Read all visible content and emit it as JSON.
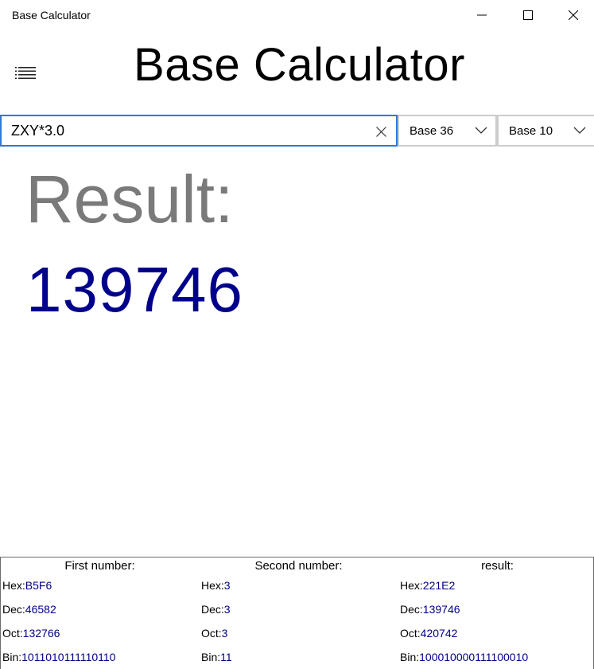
{
  "window": {
    "title": "Base Calculator",
    "controls": {
      "minimize": "minimize-icon",
      "maximize": "maximize-icon",
      "close": "close-icon"
    }
  },
  "header": {
    "menu_icon": "hamburger-menu-icon",
    "title": "Base Calculator"
  },
  "input": {
    "expression": "ZXY*3.0",
    "clear_icon": "clear-x-icon"
  },
  "selectors": {
    "from_base": "Base 36",
    "to_base": "Base 10"
  },
  "result": {
    "label": "Result:",
    "value": "139746"
  },
  "details": {
    "first": {
      "heading": "First number:",
      "hex_label": "Hex:",
      "hex": "B5F6",
      "dec_label": "Dec:",
      "dec": "46582",
      "oct_label": "Oct:",
      "oct": "132766",
      "bin_label": "Bin:",
      "bin": "1011010111110110"
    },
    "second": {
      "heading": "Second number:",
      "hex_label": "Hex:",
      "hex": "3",
      "dec_label": "Dec:",
      "dec": "3",
      "oct_label": "Oct:",
      "oct": "3",
      "bin_label": "Bin:",
      "bin": "11"
    },
    "result": {
      "heading": "result:",
      "hex_label": "Hex:",
      "hex": "221E2",
      "dec_label": "Dec:",
      "dec": "139746",
      "oct_label": "Oct:",
      "oct": "420742",
      "bin_label": "Bin:",
      "bin": "100010000111100010"
    }
  },
  "colors": {
    "accent_border": "#2b7ad6",
    "result_value": "#00008b",
    "result_label": "#7a7a7a"
  }
}
